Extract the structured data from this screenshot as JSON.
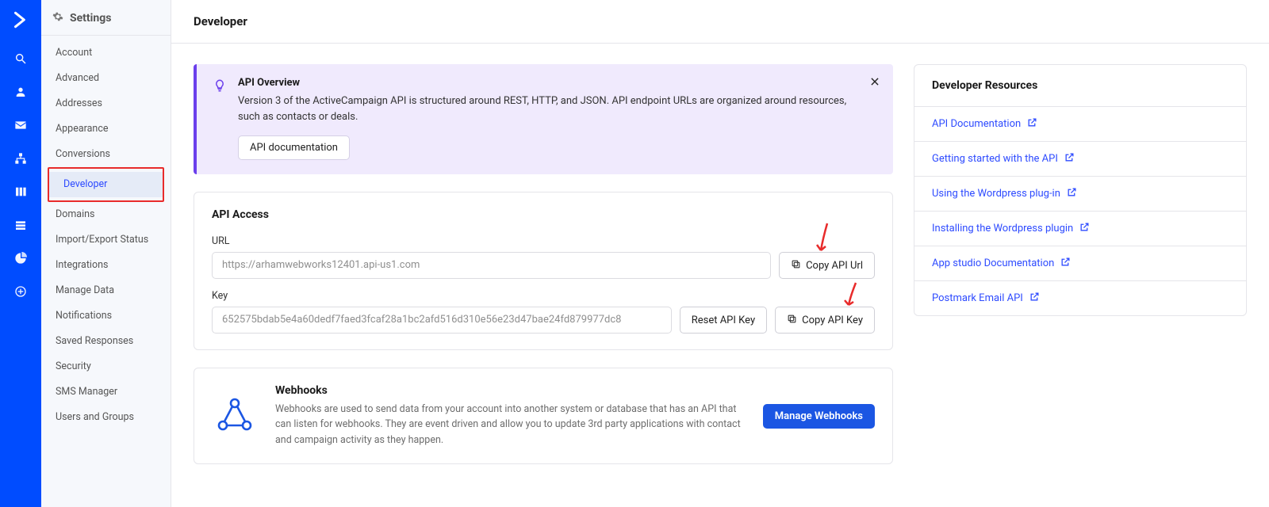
{
  "sidebar": {
    "title": "Settings",
    "items": [
      {
        "label": "Account"
      },
      {
        "label": "Advanced"
      },
      {
        "label": "Addresses"
      },
      {
        "label": "Appearance"
      },
      {
        "label": "Conversions"
      },
      {
        "label": "Developer",
        "active": true
      },
      {
        "label": "Domains"
      },
      {
        "label": "Import/Export Status"
      },
      {
        "label": "Integrations"
      },
      {
        "label": "Manage Data"
      },
      {
        "label": "Notifications"
      },
      {
        "label": "Saved Responses"
      },
      {
        "label": "Security"
      },
      {
        "label": "SMS Manager"
      },
      {
        "label": "Users and Groups"
      }
    ]
  },
  "page": {
    "title": "Developer"
  },
  "banner": {
    "title": "API Overview",
    "desc": "Version 3 of the ActiveCampaign API is structured around REST, HTTP, and JSON. API endpoint URLs are organized around resources, such as contacts or deals.",
    "button": "API documentation"
  },
  "api_access": {
    "title": "API Access",
    "url_label": "URL",
    "url_value": "https://arhamwebworks12401.api-us1.com",
    "copy_url_label": "Copy API Url",
    "key_label": "Key",
    "key_value": "652575bdab5e4a60dedf7faed3fcaf28a1bc2afd516d310e56e23d47bae24fd879977dc8",
    "reset_key_label": "Reset API Key",
    "copy_key_label": "Copy API Key"
  },
  "webhooks": {
    "title": "Webhooks",
    "desc": "Webhooks are used to send data from your account into another system or database that has an API that can listen for webhooks. They are event driven and allow you to update 3rd party applications with contact and campaign activity as they happen.",
    "button": "Manage Webhooks"
  },
  "resources": {
    "title": "Developer Resources",
    "items": [
      {
        "label": "API Documentation"
      },
      {
        "label": "Getting started with the API"
      },
      {
        "label": "Using the Wordpress plug-in"
      },
      {
        "label": "Installing the Wordpress plugin"
      },
      {
        "label": "App studio Documentation"
      },
      {
        "label": "Postmark Email API"
      }
    ]
  }
}
